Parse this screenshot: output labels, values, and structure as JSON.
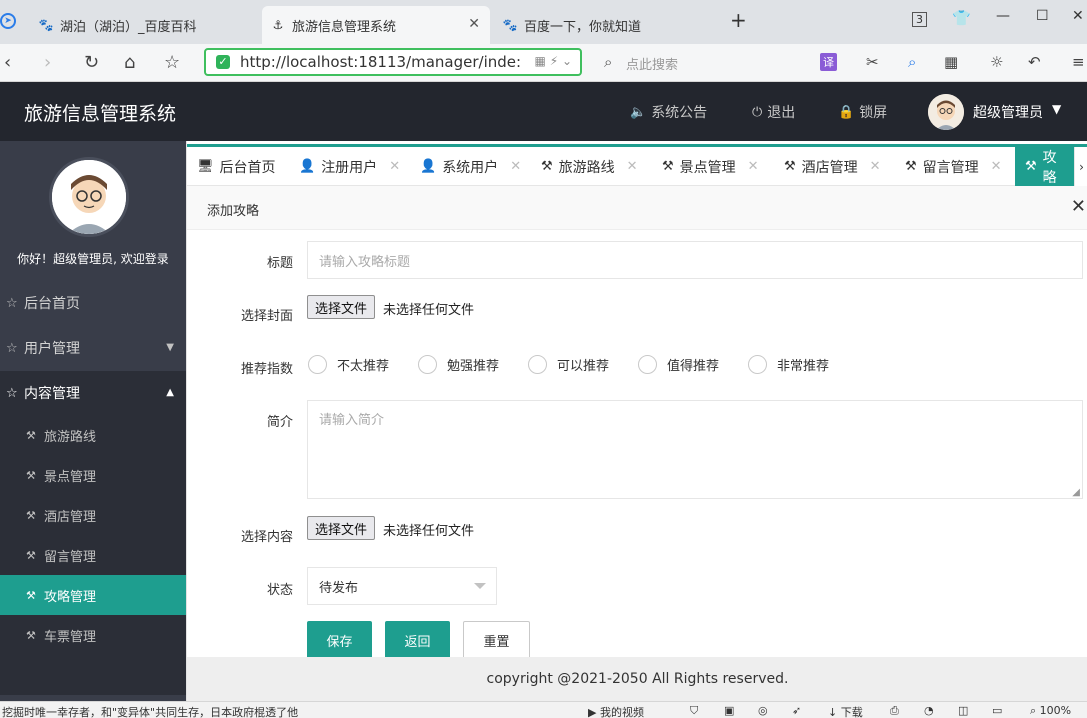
{
  "browser": {
    "tabs": [
      {
        "title": "湖泊（湖泊）_百度百科",
        "icon": "paw-icon"
      },
      {
        "title": "旅游信息管理系统",
        "icon": "page-icon"
      },
      {
        "title": "百度一下，你就知道",
        "icon": "paw-icon"
      }
    ],
    "tab_count": "3",
    "url": "http://localhost:18113/manager/inde:",
    "search_placeholder": "点此搜索",
    "translate_label": "译"
  },
  "header": {
    "title": "旅游信息管理系统",
    "announce": "系统公告",
    "logout": "退出",
    "lock": "锁屏",
    "username": "超级管理员"
  },
  "sidebar": {
    "welcome": "你好！超级管理员, 欢迎登录",
    "items": [
      {
        "label": "后台首页"
      },
      {
        "label": "用户管理"
      },
      {
        "label": "内容管理"
      }
    ],
    "sub_items": [
      {
        "label": "旅游路线"
      },
      {
        "label": "景点管理"
      },
      {
        "label": "酒店管理"
      },
      {
        "label": "留言管理"
      },
      {
        "label": "攻略管理"
      },
      {
        "label": "车票管理"
      }
    ]
  },
  "content_tabs": [
    {
      "label": "后台首页"
    },
    {
      "label": "注册用户"
    },
    {
      "label": "系统用户"
    },
    {
      "label": "旅游路线"
    },
    {
      "label": "景点管理"
    },
    {
      "label": "酒店管理"
    },
    {
      "label": "留言管理"
    },
    {
      "label": "攻略"
    }
  ],
  "form": {
    "panel_title": "添加攻略",
    "title_label": "标题",
    "title_placeholder": "请输入攻略标题",
    "cover_label": "选择封面",
    "file_button": "选择文件",
    "no_file": "未选择任何文件",
    "rating_label": "推荐指数",
    "rating_options": [
      "不太推荐",
      "勉强推荐",
      "可以推荐",
      "值得推荐",
      "非常推荐"
    ],
    "intro_label": "简介",
    "intro_placeholder": "请输入简介",
    "content_label": "选择内容",
    "status_label": "状态",
    "status_value": "待发布",
    "save": "保存",
    "back": "返回",
    "reset": "重置"
  },
  "footer": "copyright @2021-2050 All Rights reserved.",
  "statusbar": {
    "news": "挖掘时唯一幸存者，和\"变异体\"共同生存，日本政府棍透了他",
    "video": "我的视频",
    "download": "下载",
    "zoom": "100%"
  }
}
